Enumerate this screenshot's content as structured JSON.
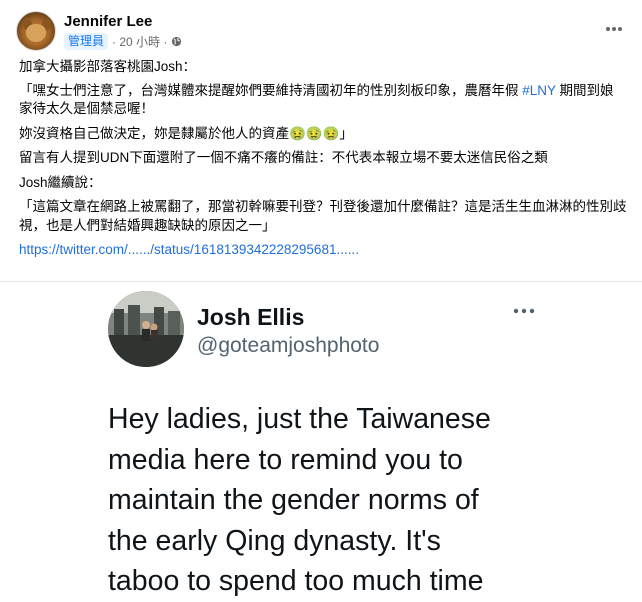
{
  "post": {
    "author": "Jennifer Lee",
    "role_badge": "管理員",
    "time": "· 20 小時 ·",
    "lines": {
      "l1": "加拿大攝影部落客桃園Josh：",
      "l2_pre": "「嘿女士們注意了，台灣媒體來提醒妳們要維持清國初年的性別刻板印象，農曆年假 ",
      "l2_tag": "#LNY",
      "l2_post": " 期間到娘家待太久是個禁忌喔！",
      "l3": "妳沒資格自己做決定，妳是隸屬於他人的資產🤢🤢🤢」",
      "l4": "留言有人提到UDN下面還附了一個不痛不癢的備註：不代表本報立場不要太迷信民俗之類",
      "l5": "Josh繼續說：",
      "l6": "「這篇文章在網路上被罵翻了，那當初幹嘛要刊登？刊登後還加什麼備註？這是活生生血淋淋的性別歧視，也是人們對結婚興趣缺缺的原因之一」",
      "link": "https://twitter.com/....../status/1618139342228295681......"
    }
  },
  "tweet": {
    "name": "Josh Ellis",
    "handle": "@goteamjoshphoto",
    "text_lines": [
      "Hey ladies, just the Taiwanese",
      "media here to remind you  to",
      "maintain the gender norms of",
      "the early Qing dynasty. It's",
      "taboo to spend too much time"
    ]
  },
  "colors": {
    "link": "#216fdb",
    "badge_bg": "#e7f3ff",
    "badge_text": "#1877f2",
    "meta": "#65676b"
  },
  "icons": {
    "visibility": "globe-icon",
    "menu": "more-options-icon"
  }
}
